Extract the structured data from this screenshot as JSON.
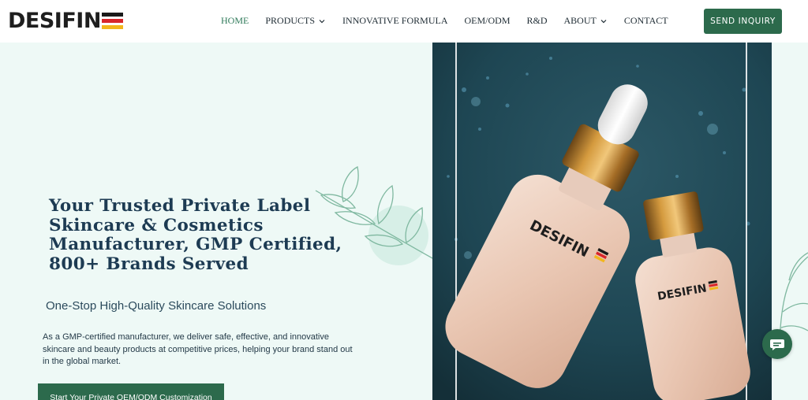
{
  "header": {
    "logo_text": "DESIFIN",
    "nav": [
      {
        "label": "HOME",
        "active": true,
        "has_dropdown": false
      },
      {
        "label": "PRODUCTS",
        "active": false,
        "has_dropdown": true
      },
      {
        "label": "INNOVATIVE FORMULA",
        "active": false,
        "has_dropdown": false
      },
      {
        "label": "OEM/ODM",
        "active": false,
        "has_dropdown": false
      },
      {
        "label": "R&D",
        "active": false,
        "has_dropdown": false
      },
      {
        "label": "ABOUT",
        "active": false,
        "has_dropdown": true
      },
      {
        "label": "CONTACT",
        "active": false,
        "has_dropdown": false
      }
    ],
    "send_button": "SEND INQUIRY"
  },
  "hero": {
    "title_lines": [
      "Your Trusted Private Label",
      "Skincare & Cosmetics",
      "Manufacturer, GMP Certified,",
      "800+ Brands Served"
    ],
    "subtitle": "One-Stop High-Quality Skincare Solutions",
    "description_lines": [
      "As a GMP-certified manufacturer, we deliver safe, effective, and innovative",
      "skincare and beauty products at competitive prices, helping your brand stand out",
      "in the global market."
    ],
    "cta": "Start Your Private OEM/ODM Customization",
    "bottle_label": "DESIFIN"
  },
  "icons": {
    "nav_dropdown": "chevron-down-icon",
    "chat": "chat-bubble-icon",
    "leaves": "leaf-branch-icon"
  },
  "colors": {
    "brand_green": "#2c6a4c",
    "active_nav": "#2f7a5a",
    "hero_bg": "#eef9f6",
    "title_navy": "#1d3b53",
    "flag_black": "#1a1a1a",
    "flag_red": "#d8262b",
    "flag_gold": "#f2b61c",
    "marble_teal": "#1e4653",
    "cap_gold": "#b9842f"
  }
}
